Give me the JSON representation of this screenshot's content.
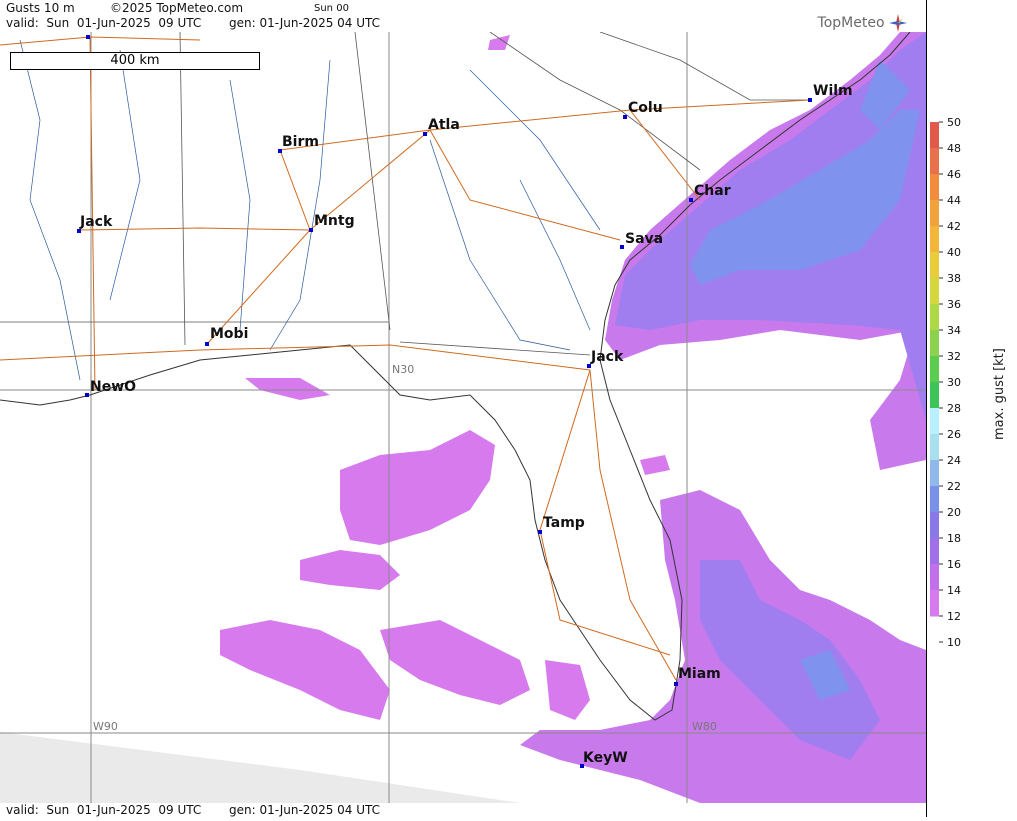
{
  "header": {
    "product": "Gusts 10 m",
    "copyright": "©2025 TopMeteo.com",
    "run": "Sun 00",
    "valid": "valid:  Sun  01-Jun-2025  09 UTC",
    "generated": "gen: 01-Jun-2025 04 UTC",
    "logo": "TopMeteo"
  },
  "footer": {
    "valid": "valid:  Sun  01-Jun-2025  09 UTC",
    "generated": "gen: 01-Jun-2025 04 UTC"
  },
  "scale_bar": "400 km",
  "grid_labels": {
    "lat": "N30",
    "lon_west": "W90",
    "lon_east": "W80"
  },
  "cities": [
    {
      "label": "Wilm"
    },
    {
      "label": "Colu"
    },
    {
      "label": "Atla"
    },
    {
      "label": "Birm"
    },
    {
      "label": "Char"
    },
    {
      "label": "Sava"
    },
    {
      "label": "Mntg"
    },
    {
      "label": "Jack"
    },
    {
      "label": "Mobi"
    },
    {
      "label": "Jack"
    },
    {
      "label": "NewO"
    },
    {
      "label": "Tamp"
    },
    {
      "label": "Miam"
    },
    {
      "label": "KeyW"
    }
  ],
  "legend": {
    "title": "max. gust [kt]",
    "ticks": [
      "50",
      "48",
      "46",
      "44",
      "42",
      "40",
      "38",
      "36",
      "34",
      "32",
      "30",
      "28",
      "26",
      "24",
      "22",
      "20",
      "18",
      "16",
      "14",
      "12",
      "10"
    ],
    "colors": [
      "#e0594a",
      "#e8704a",
      "#f08c3c",
      "#f2a23a",
      "#f2b73a",
      "#e8cc3a",
      "#d4d83e",
      "#aed846",
      "#8cd24e",
      "#5ccc4e",
      "#3cc45a",
      "#b8f0ff",
      "#a8e0f0",
      "#90b8ea",
      "#7890e8",
      "#8878e8",
      "#a070e8",
      "#c070ea",
      "#d67aee"
    ]
  }
}
